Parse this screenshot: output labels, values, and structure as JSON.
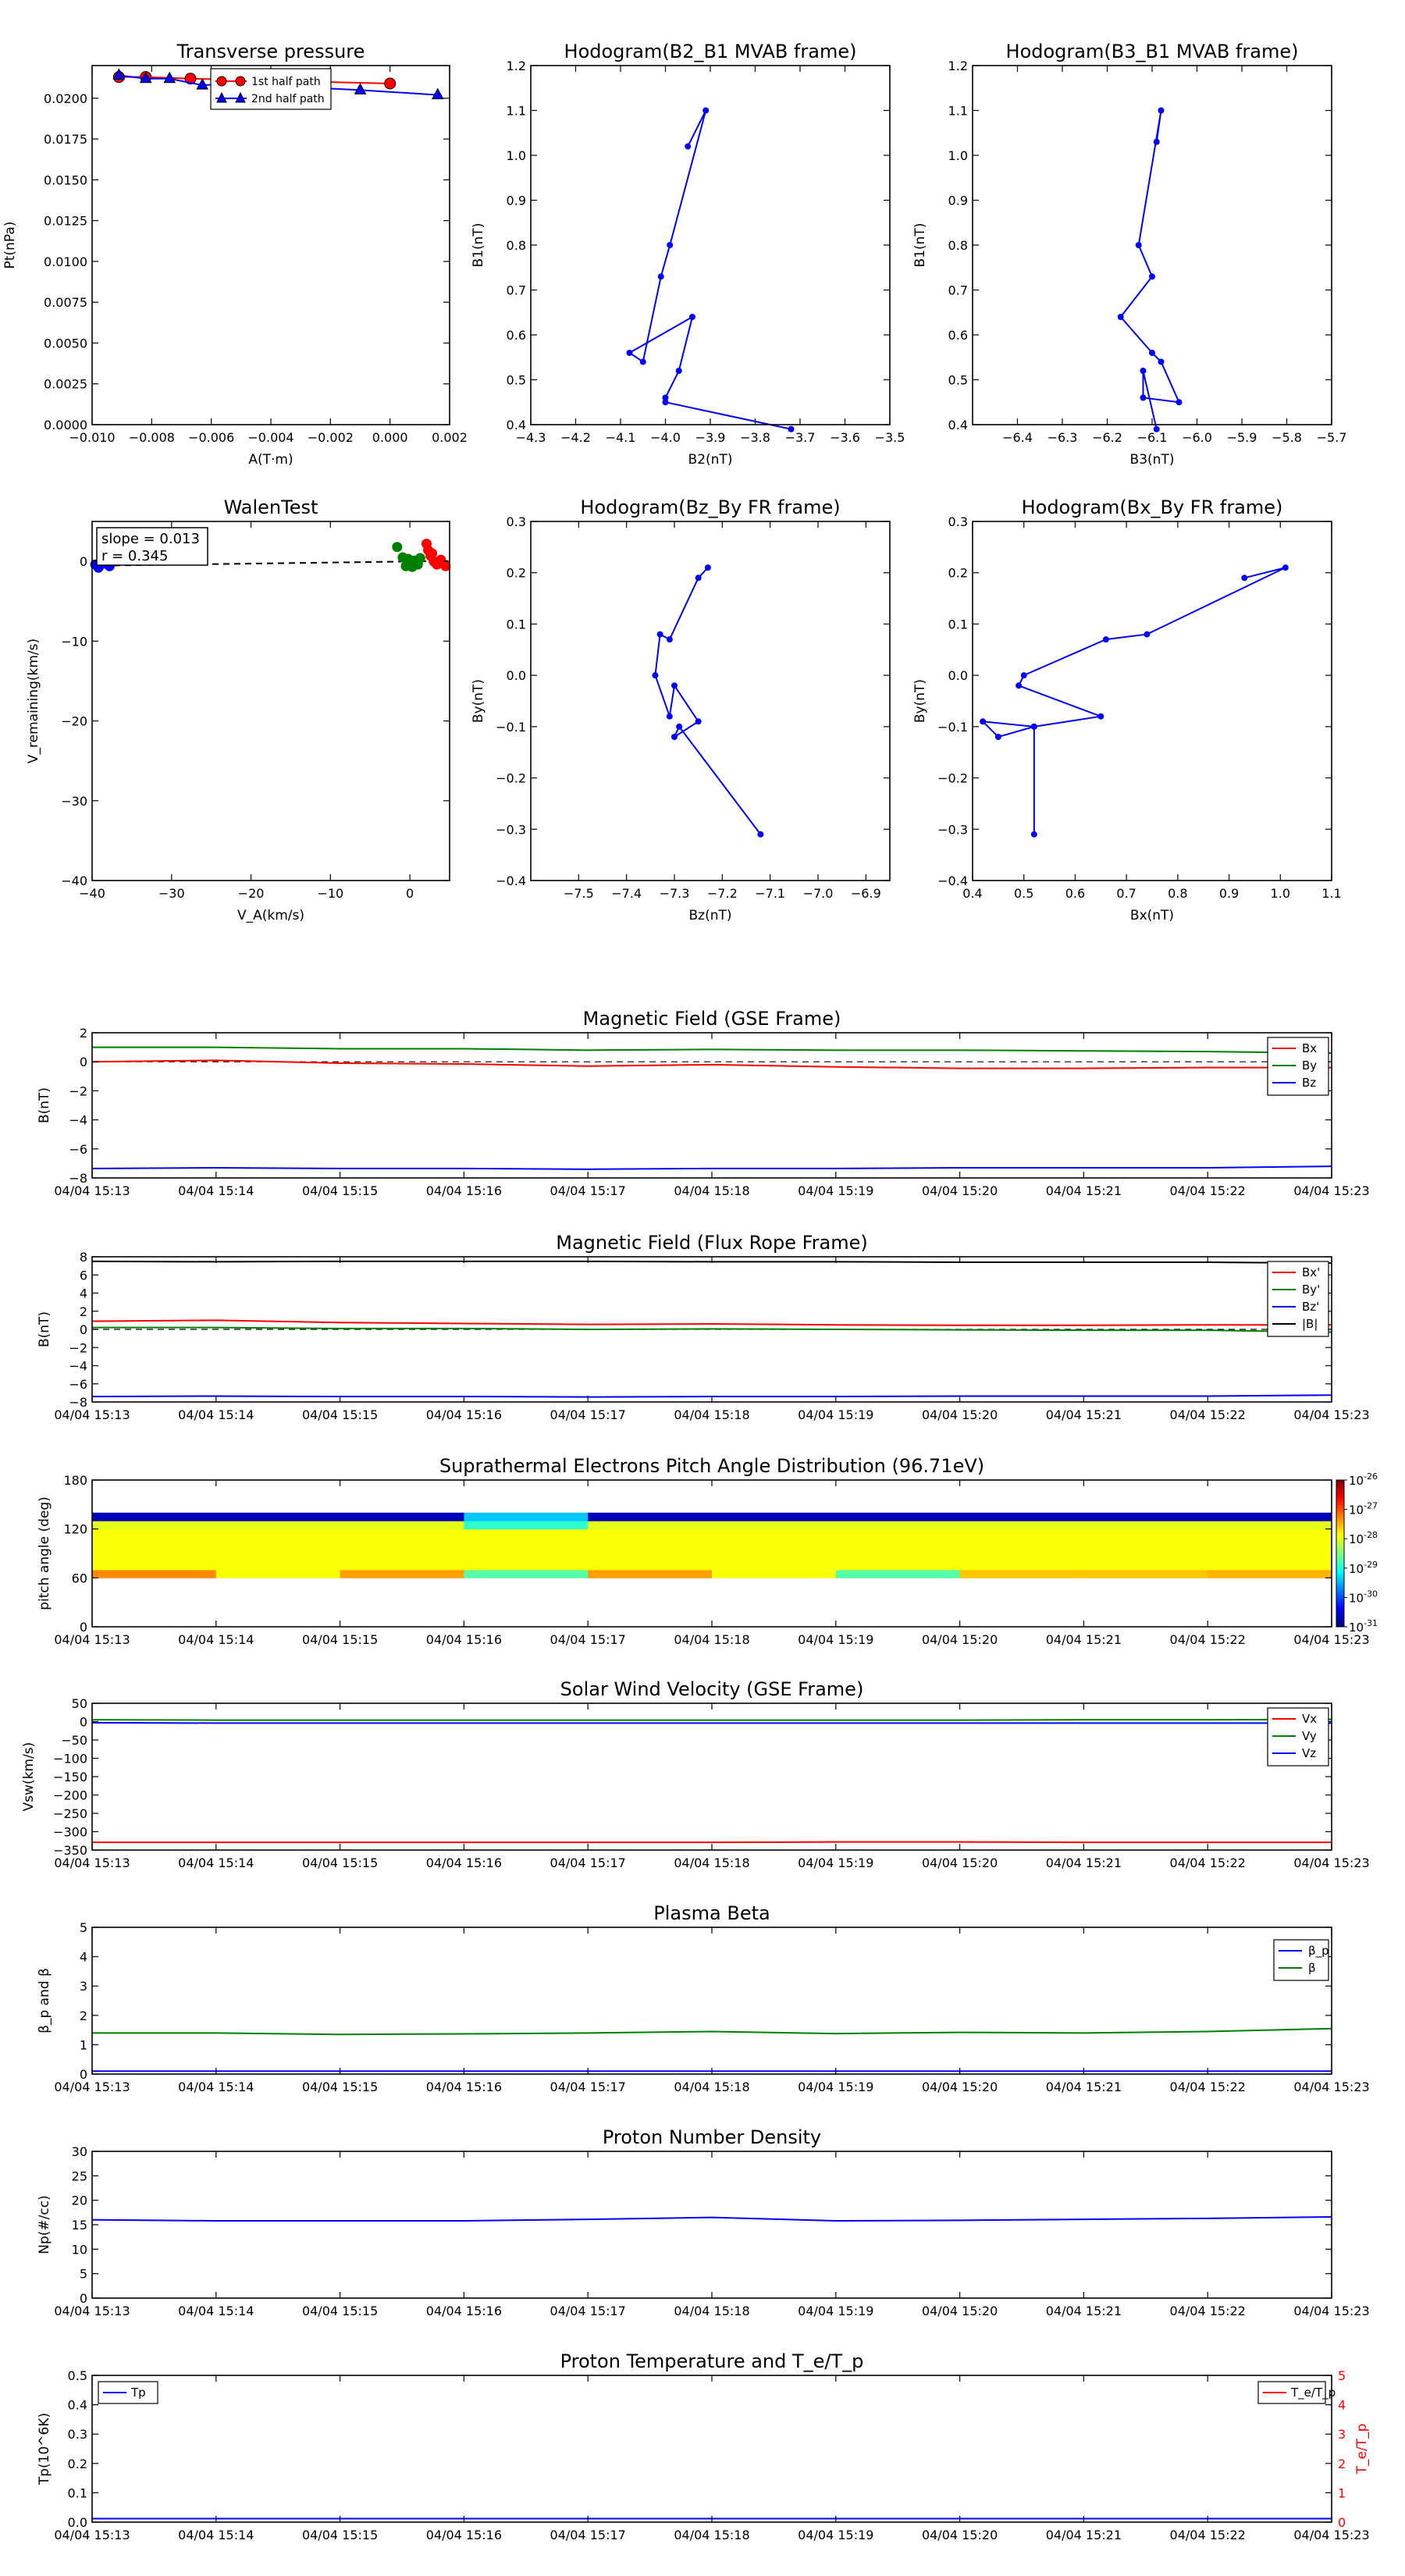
{
  "times": [
    "04/04 15:13",
    "04/04 15:14",
    "04/04 15:15",
    "04/04 15:16",
    "04/04 15:17",
    "04/04 15:18",
    "04/04 15:19",
    "04/04 15:20",
    "04/04 15:21",
    "04/04 15:22",
    "04/04 15:23"
  ],
  "colors": {
    "red": "#ff0000",
    "green": "#008000",
    "blue": "#0000ff",
    "black": "#000000",
    "cyan": "#00bfff"
  },
  "chart_data": [
    {
      "type": "scatter",
      "title": "Transverse pressure",
      "xlabel": "A(T·m)",
      "ylabel": "Pt(nPa)",
      "xlim": [
        -0.01,
        0.002
      ],
      "ylim": [
        0.0,
        0.022
      ],
      "xticks": [
        -0.01,
        -0.008,
        -0.006,
        -0.004,
        -0.002,
        0.0,
        0.002
      ],
      "xticklabels": [
        "−0.010",
        "−0.008",
        "−0.006",
        "−0.004",
        "−0.002",
        "0.000",
        "0.002"
      ],
      "yticks": [
        0,
        0.0025,
        0.005,
        0.0075,
        0.01,
        0.0125,
        0.015,
        0.0175,
        0.02
      ],
      "yticklabels": [
        "0.0000",
        "0.0025",
        "0.0050",
        "0.0075",
        "0.0100",
        "0.0125",
        "0.0150",
        "0.0175",
        "0.0200"
      ],
      "legend": [
        "1st half path",
        "2nd half path"
      ],
      "series": [
        {
          "name": "1st half path",
          "marker": "circle",
          "color": "#ff0000",
          "x": [
            -0.0091,
            -0.0082,
            -0.0067,
            0.0
          ],
          "y": [
            0.0213,
            0.0213,
            0.0212,
            0.0209
          ]
        },
        {
          "name": "2nd half path",
          "marker": "triangle",
          "color": "#0000ff",
          "x": [
            -0.0091,
            -0.0082,
            -0.0074,
            -0.0063,
            -0.005,
            -0.0032,
            -0.001,
            0.0016
          ],
          "y": [
            0.0214,
            0.0212,
            0.0212,
            0.0208,
            0.0209,
            0.0207,
            0.0205,
            0.0202
          ]
        }
      ]
    },
    {
      "type": "line",
      "title": "Hodogram(B2_B1 MVAB frame)",
      "xlabel": "B2(nT)",
      "ylabel": "B1(nT)",
      "xlim": [
        -4.3,
        -3.5
      ],
      "ylim": [
        0.4,
        1.2
      ],
      "xticks": [
        -4.3,
        -4.2,
        -4.1,
        -4.0,
        -3.9,
        -3.8,
        -3.7,
        -3.6,
        -3.5
      ],
      "xticklabels": [
        "−4.3",
        "−4.2",
        "−4.1",
        "−4.0",
        "−3.9",
        "−3.8",
        "−3.7",
        "−3.6",
        "−3.5"
      ],
      "yticks": [
        0.4,
        0.5,
        0.6,
        0.7,
        0.8,
        0.9,
        1.0,
        1.1,
        1.2
      ],
      "yticklabels": [
        "0.4",
        "0.5",
        "0.6",
        "0.7",
        "0.8",
        "0.9",
        "1.0",
        "1.1",
        "1.2"
      ],
      "x": [
        -3.95,
        -3.91,
        -3.99,
        -4.01,
        -4.05,
        -4.08,
        -3.94,
        -3.97,
        -4.0,
        -4.0,
        -3.72
      ],
      "y": [
        1.02,
        1.1,
        0.8,
        0.73,
        0.54,
        0.56,
        0.64,
        0.52,
        0.46,
        0.45,
        0.39
      ]
    },
    {
      "type": "line",
      "title": "Hodogram(B3_B1 MVAB frame)",
      "xlabel": "B3(nT)",
      "ylabel": "B1(nT)",
      "xlim": [
        -6.5,
        -5.7
      ],
      "ylim": [
        0.4,
        1.2
      ],
      "xticks": [
        -6.4,
        -6.3,
        -6.2,
        -6.1,
        -6.0,
        -5.9,
        -5.8,
        -5.7
      ],
      "xticklabels": [
        "−6.4",
        "−6.3",
        "−6.2",
        "−6.1",
        "−6.0",
        "−5.9",
        "−5.8",
        "−5.7"
      ],
      "yticks": [
        0.4,
        0.5,
        0.6,
        0.7,
        0.8,
        0.9,
        1.0,
        1.1,
        1.2
      ],
      "yticklabels": [
        "0.4",
        "0.5",
        "0.6",
        "0.7",
        "0.8",
        "0.9",
        "1.0",
        "1.1",
        "1.2"
      ],
      "x": [
        -6.09,
        -6.08,
        -6.13,
        -6.1,
        -6.17,
        -6.1,
        -6.08,
        -6.04,
        -6.12,
        -6.12,
        -6.09
      ],
      "y": [
        1.03,
        1.1,
        0.8,
        0.73,
        0.64,
        0.56,
        0.54,
        0.45,
        0.46,
        0.52,
        0.39
      ]
    },
    {
      "type": "scatter",
      "title": "WalenTest",
      "xlabel": "V_A(km/s)",
      "ylabel": "V_remaining(km/s)",
      "xlim": [
        -40,
        5
      ],
      "ylim": [
        -40,
        5
      ],
      "xticks": [
        -40,
        -30,
        -20,
        -10,
        0
      ],
      "xticklabels": [
        "−40",
        "−30",
        "−20",
        "−10",
        "0"
      ],
      "yticks": [
        -40,
        -30,
        -20,
        -10,
        0
      ],
      "yticklabels": [
        "−40",
        "−30",
        "−20",
        "−10",
        "0"
      ],
      "annotation": [
        "slope = 0.013",
        "r = 0.345"
      ],
      "fit_line": {
        "x": [
          -40,
          5
        ],
        "y": [
          -0.55,
          0.05
        ]
      },
      "series": [
        {
          "color": "#0000ff",
          "x": [
            -39.6,
            -39.2,
            -38.6,
            -37.8
          ],
          "y": [
            -0.4,
            -0.8,
            -0.3,
            -0.6
          ]
        },
        {
          "color": "#008000",
          "x": [
            -1.6,
            -0.9,
            -0.5,
            -0.2,
            0.1,
            0.3,
            0.6,
            1.0,
            1.3
          ],
          "y": [
            1.8,
            0.5,
            -0.6,
            0.3,
            -0.2,
            -0.7,
            0.1,
            -0.4,
            0.4
          ]
        },
        {
          "color": "#ff0000",
          "x": [
            2.1,
            2.3,
            2.6,
            3.0,
            3.4,
            3.9,
            4.5,
            2.8
          ],
          "y": [
            2.2,
            1.4,
            0.7,
            0.0,
            -0.4,
            0.2,
            -0.6,
            1.0
          ]
        }
      ]
    },
    {
      "type": "line",
      "title": "Hodogram(Bz_By FR frame)",
      "xlabel": "Bz(nT)",
      "ylabel": "By(nT)",
      "xlim": [
        -7.6,
        -6.85
      ],
      "ylim": [
        -0.4,
        0.3
      ],
      "xticks": [
        -7.5,
        -7.4,
        -7.3,
        -7.2,
        -7.1,
        -7.0,
        -6.9
      ],
      "xticklabels": [
        "−7.5",
        "−7.4",
        "−7.3",
        "−7.2",
        "−7.1",
        "−7.0",
        "−6.9"
      ],
      "yticks": [
        -0.4,
        -0.3,
        -0.2,
        -0.1,
        0.0,
        0.1,
        0.2,
        0.3
      ],
      "yticklabels": [
        "−0.4",
        "−0.3",
        "−0.2",
        "−0.1",
        "0.0",
        "0.1",
        "0.2",
        "0.3"
      ],
      "x": [
        -7.23,
        -7.25,
        -7.31,
        -7.33,
        -7.34,
        -7.31,
        -7.3,
        -7.25,
        -7.3,
        -7.29,
        -7.12
      ],
      "y": [
        0.21,
        0.19,
        0.07,
        0.08,
        0.0,
        -0.08,
        -0.02,
        -0.09,
        -0.12,
        -0.1,
        -0.31
      ]
    },
    {
      "type": "line",
      "title": "Hodogram(Bx_By FR frame)",
      "xlabel": "Bx(nT)",
      "ylabel": "By(nT)",
      "xlim": [
        0.4,
        1.1
      ],
      "ylim": [
        -0.4,
        0.3
      ],
      "xticks": [
        0.4,
        0.5,
        0.6,
        0.7,
        0.8,
        0.9,
        1.0,
        1.1
      ],
      "xticklabels": [
        "0.4",
        "0.5",
        "0.6",
        "0.7",
        "0.8",
        "0.9",
        "1.0",
        "1.1"
      ],
      "yticks": [
        -0.4,
        -0.3,
        -0.2,
        -0.1,
        0.0,
        0.1,
        0.2,
        0.3
      ],
      "yticklabels": [
        "−0.4",
        "−0.3",
        "−0.2",
        "−0.1",
        "0.0",
        "0.1",
        "0.2",
        "0.3"
      ],
      "x": [
        0.93,
        1.01,
        0.74,
        0.66,
        0.5,
        0.49,
        0.65,
        0.52,
        0.45,
        0.42,
        0.52,
        0.52
      ],
      "y": [
        0.19,
        0.21,
        0.08,
        0.07,
        0.0,
        -0.02,
        -0.08,
        -0.1,
        -0.12,
        -0.09,
        -0.1,
        -0.31
      ]
    },
    {
      "type": "line",
      "title": "Magnetic Field (GSE Frame)",
      "ylabel": "B(nT)",
      "ylim": [
        -8,
        2
      ],
      "yticks": [
        -8,
        -6,
        -4,
        -2,
        0,
        2
      ],
      "yticklabels": [
        "−8",
        "−6",
        "−4",
        "−2",
        "0",
        "2"
      ],
      "zero_line": true,
      "legend_position": "upper right",
      "series": [
        {
          "name": "Bx",
          "color": "#ff0000",
          "values": [
            0.0,
            0.1,
            -0.1,
            -0.15,
            -0.3,
            -0.2,
            -0.35,
            -0.45,
            -0.45,
            -0.4,
            -0.4
          ]
        },
        {
          "name": "By",
          "color": "#008000",
          "values": [
            1.0,
            1.0,
            0.9,
            0.9,
            0.8,
            0.85,
            0.8,
            0.8,
            0.75,
            0.7,
            0.6
          ]
        },
        {
          "name": "Bz",
          "color": "#0000ff",
          "values": [
            -7.35,
            -7.3,
            -7.35,
            -7.35,
            -7.4,
            -7.35,
            -7.35,
            -7.3,
            -7.3,
            -7.3,
            -7.2
          ]
        }
      ]
    },
    {
      "type": "line",
      "title": "Magnetic Field (Flux Rope Frame)",
      "ylabel": "B(nT)",
      "ylim": [
        -8,
        8
      ],
      "yticks": [
        -8,
        -6,
        -4,
        -2,
        0,
        2,
        4,
        6,
        8
      ],
      "yticklabels": [
        "−8",
        "−6",
        "−4",
        "−2",
        "0",
        "2",
        "4",
        "6",
        "8"
      ],
      "zero_line": true,
      "legend_position": "upper right",
      "series": [
        {
          "name": "Bx'",
          "color": "#ff0000",
          "values": [
            0.9,
            1.0,
            0.75,
            0.65,
            0.55,
            0.6,
            0.5,
            0.45,
            0.45,
            0.5,
            0.5
          ]
        },
        {
          "name": "By'",
          "color": "#008000",
          "values": [
            0.2,
            0.2,
            0.1,
            0.1,
            0.0,
            0.05,
            0.0,
            -0.05,
            -0.1,
            -0.1,
            -0.3
          ]
        },
        {
          "name": "Bz'",
          "color": "#0000ff",
          "values": [
            -7.4,
            -7.35,
            -7.4,
            -7.4,
            -7.45,
            -7.4,
            -7.4,
            -7.35,
            -7.35,
            -7.35,
            -7.25
          ]
        },
        {
          "name": "|B|",
          "color": "#000000",
          "values": [
            7.5,
            7.45,
            7.5,
            7.5,
            7.5,
            7.45,
            7.45,
            7.4,
            7.4,
            7.4,
            7.3
          ]
        }
      ]
    },
    {
      "type": "heatmap",
      "title": "Suprathermal Electrons Pitch Angle Distribution (96.71eV)",
      "ylabel": "pitch angle (deg)",
      "ylim": [
        0,
        180
      ],
      "yticks": [
        0,
        60,
        120,
        180
      ],
      "yticklabels": [
        "0",
        "60",
        "120",
        "180"
      ],
      "colorbar_ticks": [
        "10^-31",
        "10^-30",
        "10^-29",
        "10^-28",
        "10^-27",
        "10^-26"
      ],
      "colorbar_labels": [
        {
          "base": "10",
          "exp": "-31"
        },
        {
          "base": "10",
          "exp": "-30"
        },
        {
          "base": "10",
          "exp": "-29"
        },
        {
          "base": "10",
          "exp": "-28"
        },
        {
          "base": "10",
          "exp": "-27"
        },
        {
          "base": "10",
          "exp": "-26"
        }
      ],
      "colorbar_log_range": [
        -31,
        -26
      ],
      "bins": [
        [
          60,
          70
        ],
        [
          70,
          80
        ],
        [
          80,
          90
        ],
        [
          90,
          100
        ],
        [
          100,
          110
        ],
        [
          110,
          120
        ],
        [
          120,
          130
        ],
        [
          130,
          140
        ]
      ],
      "values_log10": [
        [
          -27.3,
          -27.9,
          -27.9,
          -27.9,
          -27.9,
          -27.9,
          -28.0,
          -30.7
        ],
        [
          -27.9,
          -27.9,
          -27.9,
          -27.9,
          -27.9,
          -27.9,
          -28.0,
          -30.7
        ],
        [
          -27.4,
          -27.9,
          -27.9,
          -27.9,
          -27.9,
          -27.9,
          -28.0,
          -30.7
        ],
        [
          -28.7,
          -27.9,
          -27.9,
          -27.9,
          -27.9,
          -27.9,
          -28.9,
          -29.4
        ],
        [
          -27.4,
          -27.9,
          -27.9,
          -27.9,
          -27.9,
          -27.9,
          -28.0,
          -30.7
        ],
        [
          -27.9,
          -27.9,
          -27.9,
          -27.9,
          -27.9,
          -27.9,
          -28.0,
          -30.7
        ],
        [
          -28.7,
          -27.9,
          -27.9,
          -27.9,
          -27.9,
          -27.9,
          -28.0,
          -30.7
        ],
        [
          -27.6,
          -27.9,
          -27.9,
          -27.9,
          -27.9,
          -27.9,
          -28.0,
          -30.7
        ],
        [
          -27.6,
          -27.9,
          -27.9,
          -27.9,
          -27.9,
          -27.9,
          -28.0,
          -30.7
        ],
        [
          -27.5,
          -27.9,
          -27.9,
          -27.9,
          -27.9,
          -27.9,
          -28.0,
          -30.7
        ]
      ]
    },
    {
      "type": "line",
      "title": "Solar Wind Velocity (GSE Frame)",
      "ylabel": "Vsw(km/s)",
      "ylim": [
        -350,
        50
      ],
      "yticks": [
        -350,
        -300,
        -250,
        -200,
        -150,
        -100,
        -50,
        0,
        50
      ],
      "yticklabels": [
        "−350",
        "−300",
        "−250",
        "−200",
        "−150",
        "−100",
        "−50",
        "0",
        "50"
      ],
      "legend_position": "upper right",
      "series": [
        {
          "name": "Vx",
          "color": "#ff0000",
          "values": [
            -329,
            -329,
            -329,
            -329,
            -329,
            -329,
            -328,
            -328,
            -329,
            -329,
            -329
          ]
        },
        {
          "name": "Vy",
          "color": "#008000",
          "values": [
            5,
            4,
            4,
            4,
            4,
            4,
            4,
            4,
            5,
            5,
            6
          ]
        },
        {
          "name": "Vz",
          "color": "#0000ff",
          "values": [
            -3,
            -4,
            -4,
            -4,
            -4,
            -4,
            -4,
            -4,
            -4,
            -4,
            -4
          ]
        }
      ]
    },
    {
      "type": "line",
      "title": "Plasma Beta",
      "ylabel": "β_p and β",
      "ylim": [
        0,
        5
      ],
      "yticks": [
        0,
        1,
        2,
        3,
        4,
        5
      ],
      "yticklabels": [
        "0",
        "1",
        "2",
        "3",
        "4",
        "5"
      ],
      "legend_position": "upper right",
      "series": [
        {
          "name": "β_p",
          "color": "#0000ff",
          "values": [
            0.1,
            0.1,
            0.1,
            0.1,
            0.1,
            0.1,
            0.1,
            0.1,
            0.1,
            0.1,
            0.1
          ]
        },
        {
          "name": "β",
          "color": "#008000",
          "values": [
            1.4,
            1.4,
            1.35,
            1.37,
            1.4,
            1.45,
            1.38,
            1.42,
            1.4,
            1.45,
            1.55
          ]
        }
      ]
    },
    {
      "type": "line",
      "title": "Proton Number Density",
      "ylabel": "Np(#/cc)",
      "ylim": [
        0,
        30
      ],
      "yticks": [
        0,
        5,
        10,
        15,
        20,
        25,
        30
      ],
      "yticklabels": [
        "0",
        "5",
        "10",
        "15",
        "20",
        "25",
        "30"
      ],
      "series": [
        {
          "color": "#0000ff",
          "values": [
            16.0,
            15.8,
            15.8,
            15.8,
            16.1,
            16.5,
            15.8,
            15.9,
            16.1,
            16.3,
            16.6
          ]
        }
      ]
    },
    {
      "type": "line",
      "title": "Proton Temperature and T_e/T_p",
      "ylabel": "Tp(10^6K)",
      "ylabel2": "T_e/T_p",
      "ylim": [
        0,
        0.5
      ],
      "ylim2": [
        0,
        5
      ],
      "yticks": [
        0,
        0.1,
        0.2,
        0.3,
        0.4,
        0.5
      ],
      "yticklabels": [
        "0.0",
        "0.1",
        "0.2",
        "0.3",
        "0.4",
        "0.5"
      ],
      "yticks2": [
        0,
        1,
        2,
        3,
        4,
        5
      ],
      "yticklabels2": [
        "0",
        "1",
        "2",
        "3",
        "4",
        "5"
      ],
      "series": [
        {
          "name": "Tp",
          "color": "#0000ff",
          "values": [
            0.012,
            0.012,
            0.012,
            0.012,
            0.012,
            0.012,
            0.012,
            0.012,
            0.012,
            0.012,
            0.012
          ]
        }
      ],
      "series2": [
        {
          "name": "T_e/T_p",
          "color": "#ff0000",
          "values": []
        }
      ]
    }
  ]
}
